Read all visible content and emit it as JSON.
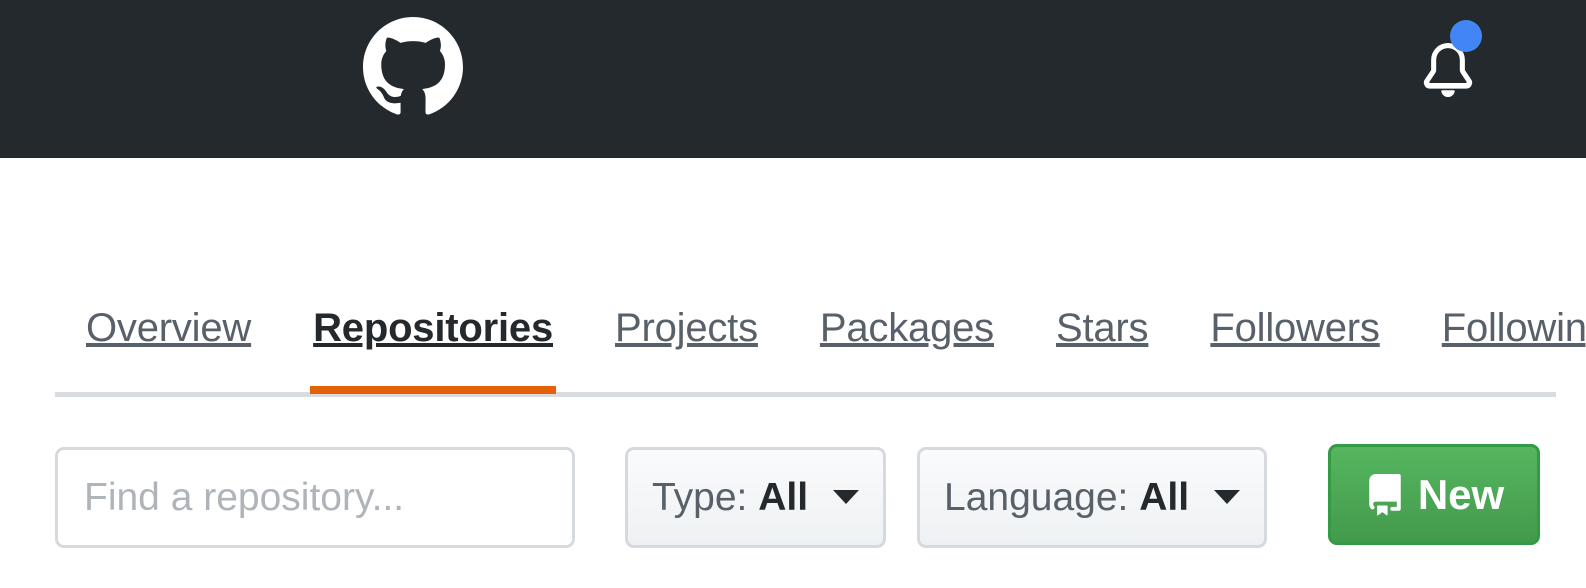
{
  "header": {
    "logo_icon": "github-octocat-logo",
    "notifications": {
      "icon": "bell-icon",
      "has_unread": true,
      "dot_color": "#4285f4"
    },
    "background_color": "#24292e"
  },
  "tabnav": {
    "items": [
      {
        "label": "Overview",
        "selected": false
      },
      {
        "label": "Repositories",
        "selected": true
      },
      {
        "label": "Projects",
        "selected": false
      },
      {
        "label": "Packages",
        "selected": false
      },
      {
        "label": "Stars",
        "selected": false
      },
      {
        "label": "Followers",
        "selected": false
      },
      {
        "label": "Following",
        "selected": false
      }
    ],
    "selected_underline_color": "#e36209",
    "rail_color": "#d8dce0"
  },
  "filterbar": {
    "search": {
      "placeholder": "Find a repository...",
      "value": ""
    },
    "type_filter": {
      "label": "Type:",
      "value": "All",
      "caret_icon": "chevron-down-icon"
    },
    "language_filter": {
      "label": "Language:",
      "value": "All",
      "caret_icon": "chevron-down-icon"
    },
    "new_button": {
      "label": "New",
      "icon": "repo-icon",
      "color": "#2ea44f"
    }
  }
}
